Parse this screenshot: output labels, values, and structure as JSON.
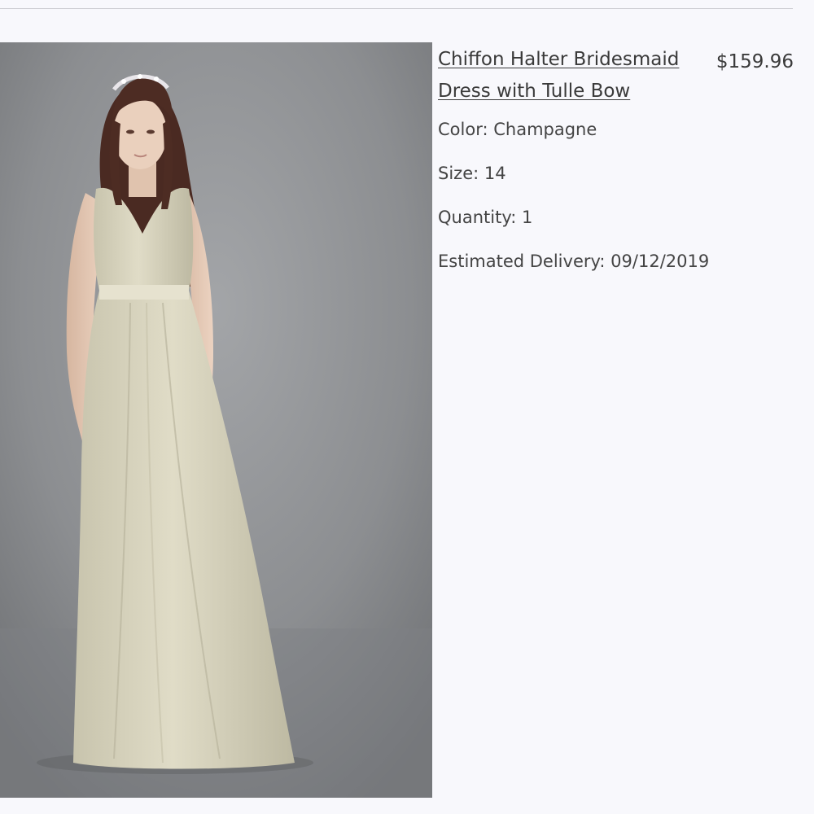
{
  "product": {
    "title": "Chiffon Halter Bridesmaid Dress with Tulle Bow",
    "price": "$159.96",
    "image_alt": "Model wearing long champagne chiffon halter dress with satin waist sash",
    "color_label": "Color:",
    "color_value": "Champagne",
    "size_label": "Size:",
    "size_value": "14",
    "quantity_label": "Quantity:",
    "quantity_value": "1",
    "delivery_label": "Estimated Delivery:",
    "delivery_value": "09/12/2019"
  },
  "colors": {
    "background": "#f8f8fc",
    "backdrop": "#8e9093",
    "dress": "#d9d5c0",
    "text": "#3a3a3a"
  }
}
